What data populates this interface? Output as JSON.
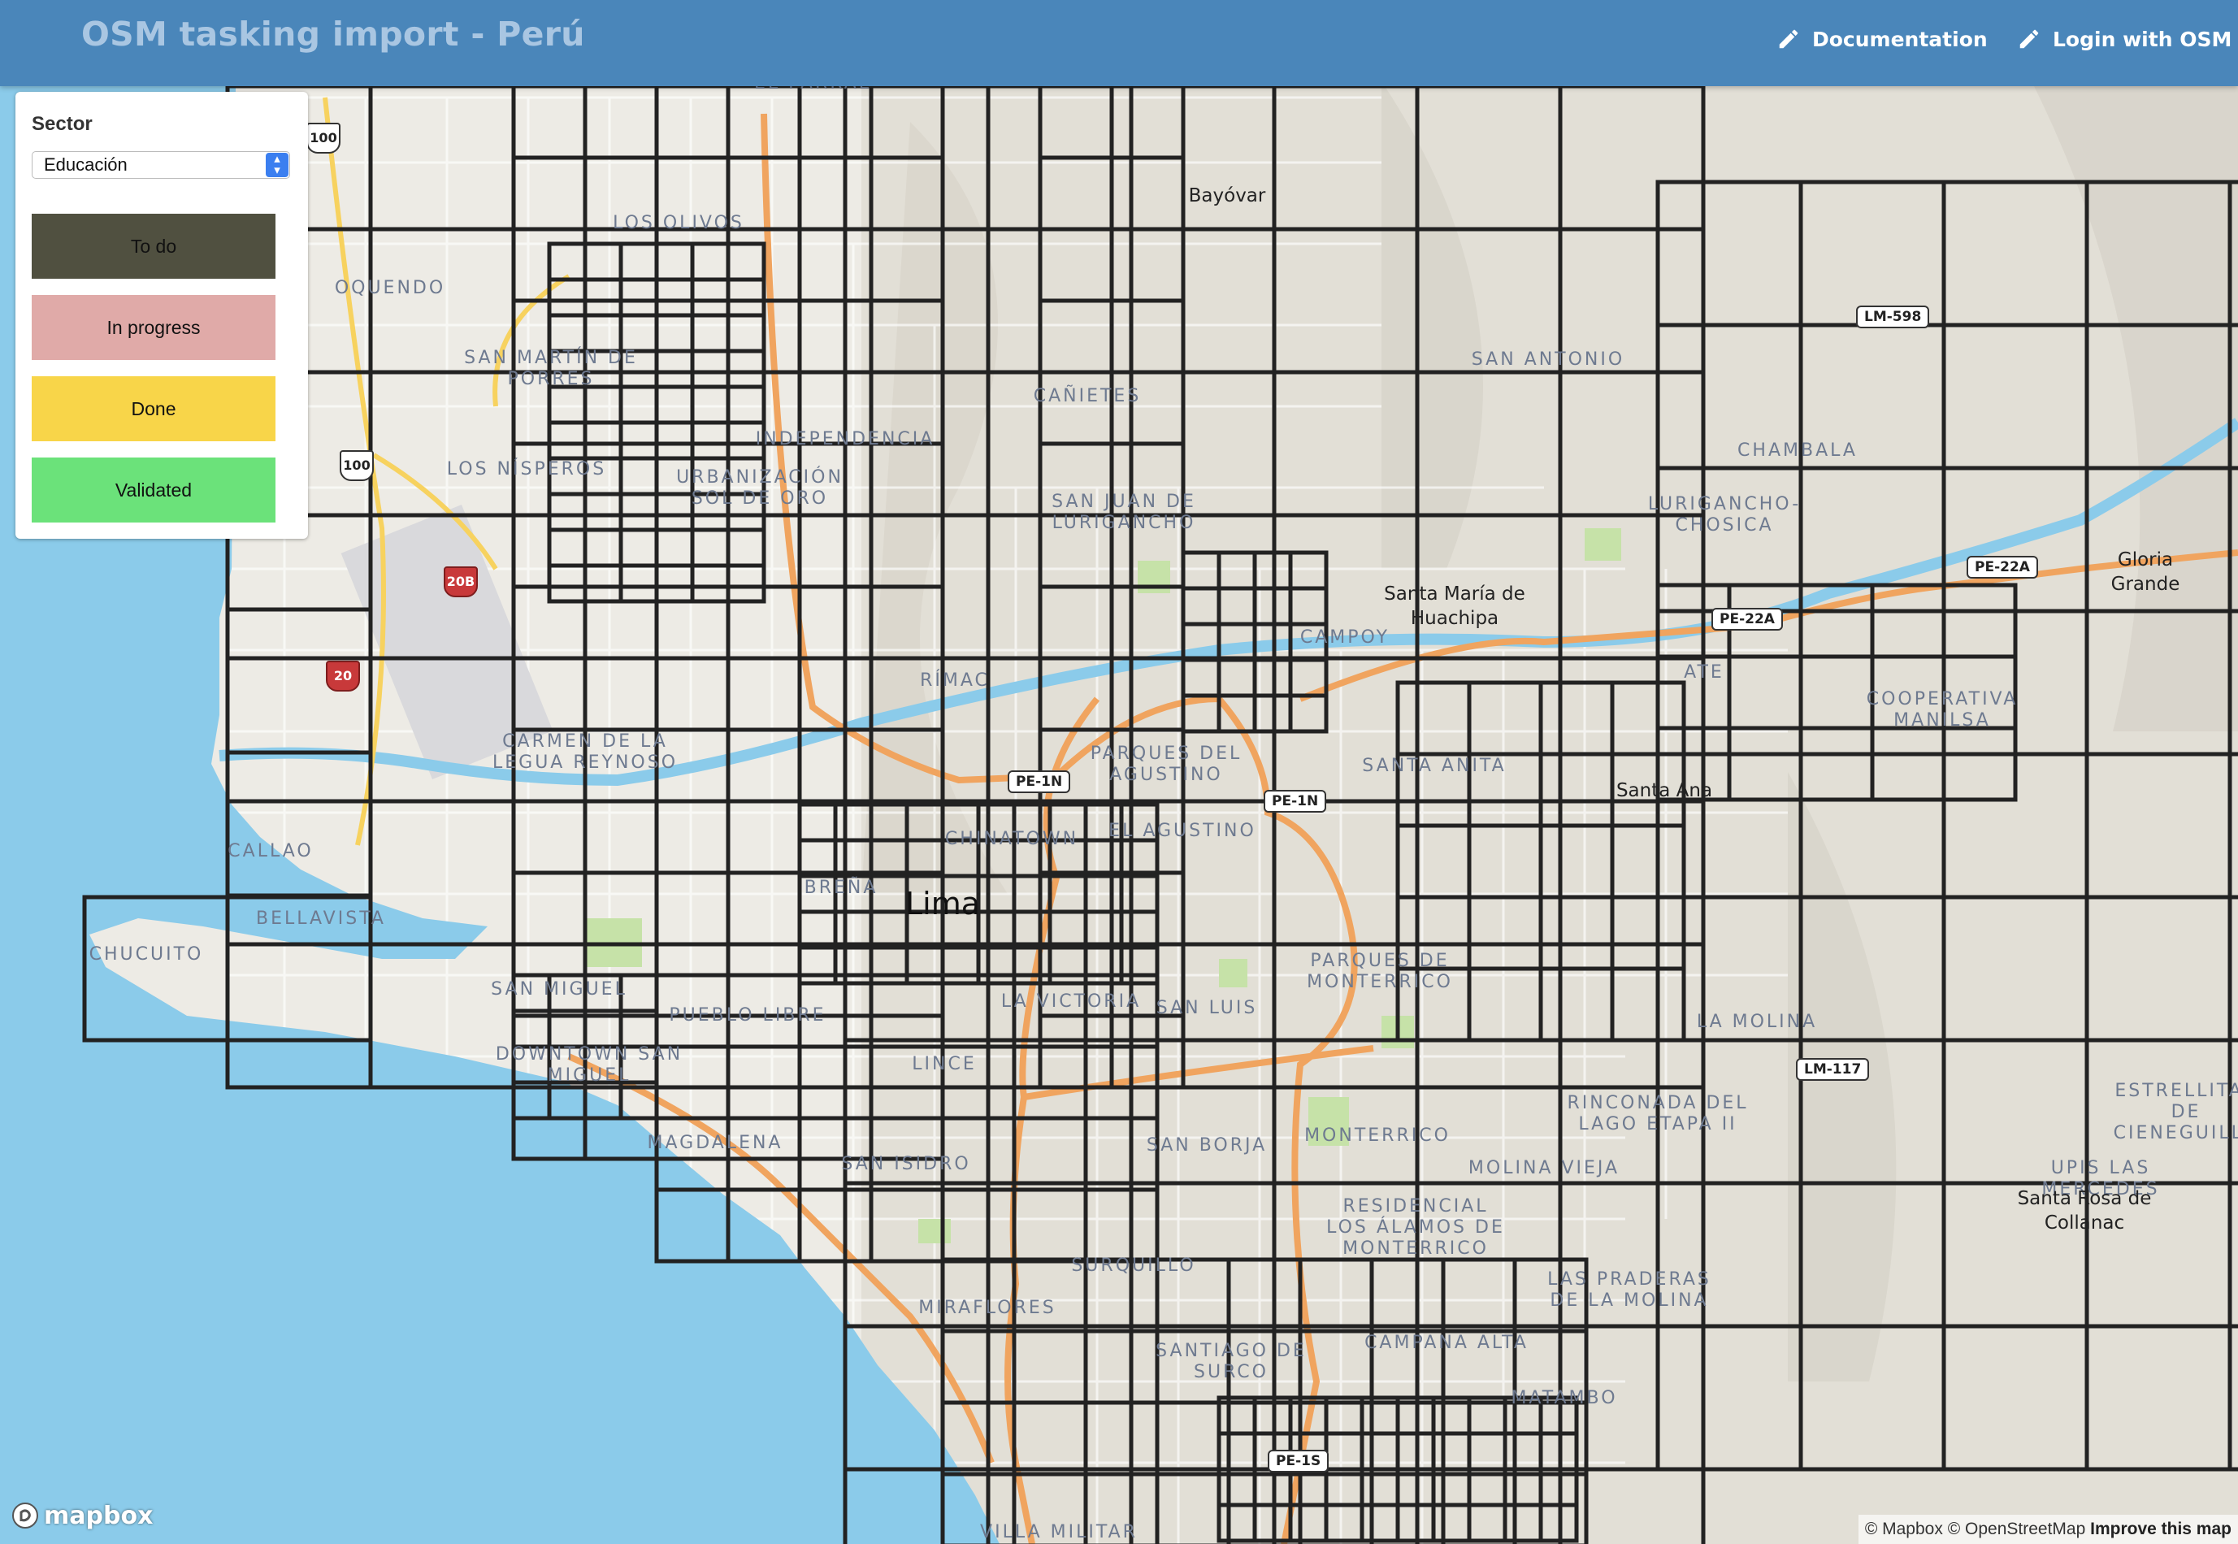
{
  "navbar": {
    "brand": "OSM tasking import - Perú",
    "documentation": "Documentation",
    "login": "Login with OSM"
  },
  "panel": {
    "title": "Sector",
    "selected_sector": "Educación",
    "legend": [
      {
        "label": "To do",
        "color": "#505040"
      },
      {
        "label": "In progress",
        "color": "#e0aaa8"
      },
      {
        "label": "Done",
        "color": "#f8d549"
      },
      {
        "label": "Validated",
        "color": "#6be27a"
      }
    ]
  },
  "map": {
    "district_labels": [
      "EL PARRAL",
      "LOS OLIVOS",
      "OQUENDO",
      "SAN MARTÍN DE PORRES",
      "INDEPENDENCIA",
      "LOS NÍSPEROS",
      "URBANIZACIÓN SOL DE ORO",
      "CAÑIETES",
      "SAN JUAN DE LURIGANCHO",
      "SAN ANTONIO",
      "CHAMBALA",
      "LURIGANCHO-CHOSICA",
      "CAMPOY",
      "RÍMAC",
      "ATE",
      "COOPERATIVA MANILSA",
      "CARMEN DE LA LEGUA REYNOSO",
      "PARQUES DEL AGUSTINO",
      "SANTA ANITA",
      "CALLAO",
      "EL AGUSTINO",
      "CHINATOWN",
      "BREÑA",
      "BELLAVISTA",
      "CHUCUITO",
      "SAN MIGUEL",
      "PUEBLO LIBRE",
      "PARQUES DE MONTERRICO",
      "LA VICTORIA",
      "SAN LUIS",
      "LA MOLINA",
      "ESTRELLITAS DE CIENEGUILLA",
      "DOWNTOWN SAN MIGUEL",
      "LINCE",
      "RINCONADA DEL LAGO ETAPA II",
      "MAGDALENA",
      "SAN ISIDRO",
      "SAN BORJA",
      "MONTERRICO",
      "MOLINA VIEJA",
      "UPIS LAS MERCEDES",
      "RESIDENCIAL LOS ÁLAMOS DE MONTERRICO",
      "SURQUILLO",
      "LAS PRADERAS DE LA MOLINA",
      "MIRAFLORES",
      "SANTIAGO DE SURCO",
      "CAMPANA ALTA",
      "MATAMBO",
      "VILLA MILITAR"
    ],
    "place_labels": [
      "Bayóvar",
      "Santa María de Huachipa",
      "Gloria Grande",
      "Santa Ana",
      "Santa Rosa de Collanac"
    ],
    "city_label": "Lima",
    "road_shields": [
      "LM-598",
      "PE-22A",
      "PE-22A",
      "PE-1N",
      "PE-1N",
      "LM-117",
      "PE-1S"
    ],
    "us_shields": [
      "100",
      "100",
      "20B",
      "20"
    ]
  },
  "attribution": {
    "logo": "mapbox",
    "mapbox": "© Mapbox",
    "osm": "© OpenStreetMap",
    "improve": "Improve this map"
  }
}
